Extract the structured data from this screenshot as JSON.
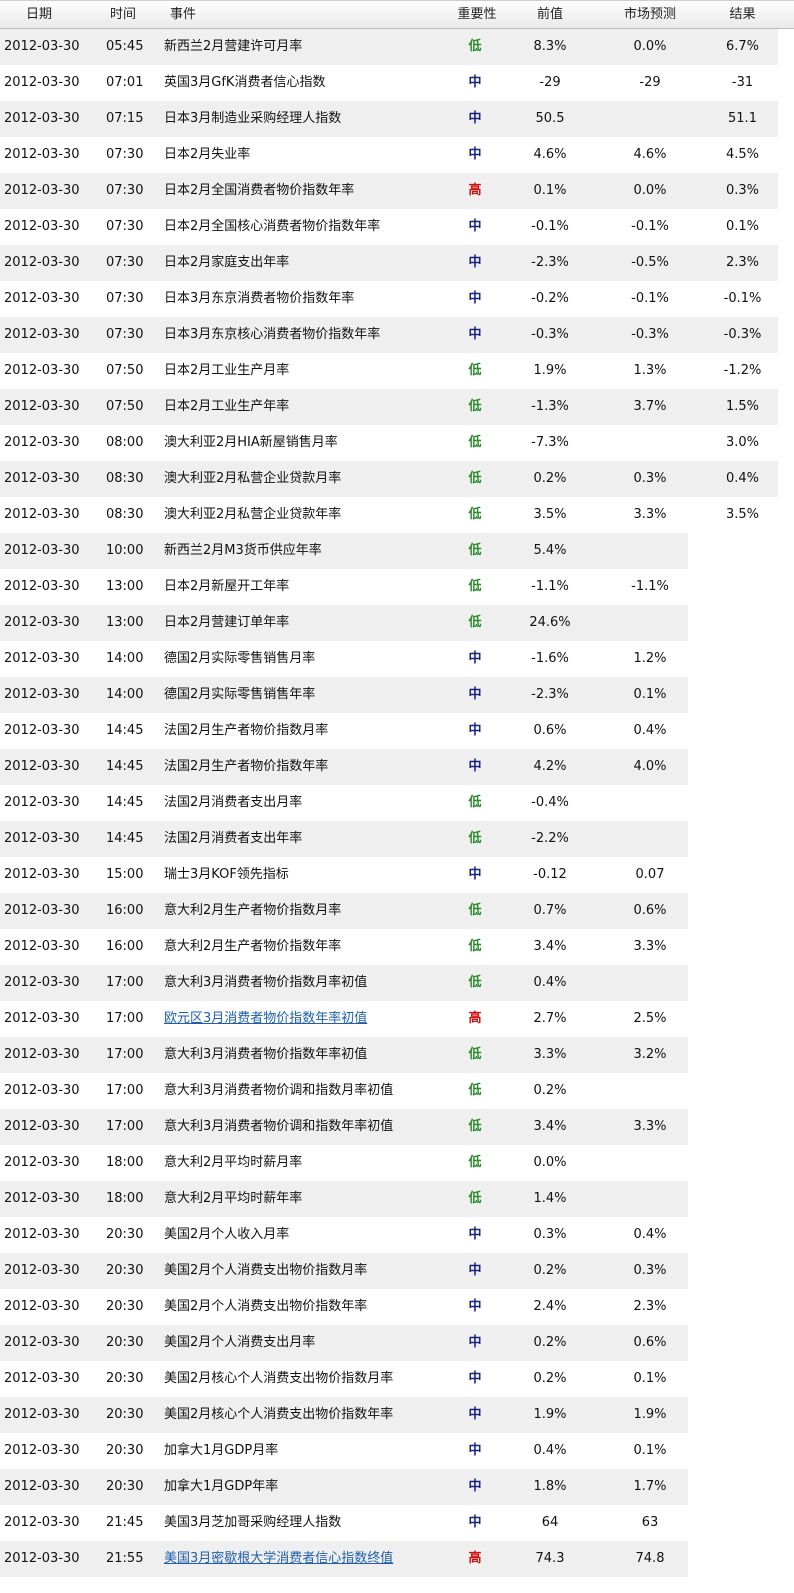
{
  "header": {
    "date": "日期",
    "time": "时间",
    "event": "事件",
    "importance": "重要性",
    "previous": "前值",
    "forecast": "市场预测",
    "actual": "结果"
  },
  "colors": {
    "low": "#2e8b2e",
    "medium": "#1a237e",
    "high": "#cc1111",
    "link": "#1f5fae"
  },
  "rows": [
    {
      "date": "2012-03-30",
      "time": "05:45",
      "event": "新西兰2月营建许可月率",
      "imp": "低",
      "prev": "8.3%",
      "fore": "0.0%",
      "act": "6.7%",
      "link": false
    },
    {
      "date": "2012-03-30",
      "time": "07:01",
      "event": "英国3月GfK消费者信心指数",
      "imp": "中",
      "prev": "-29",
      "fore": "-29",
      "act": "-31",
      "link": false
    },
    {
      "date": "2012-03-30",
      "time": "07:15",
      "event": "日本3月制造业采购经理人指数",
      "imp": "中",
      "prev": "50.5",
      "fore": "",
      "act": "51.1",
      "link": false
    },
    {
      "date": "2012-03-30",
      "time": "07:30",
      "event": "日本2月失业率",
      "imp": "中",
      "prev": "4.6%",
      "fore": "4.6%",
      "act": "4.5%",
      "link": false
    },
    {
      "date": "2012-03-30",
      "time": "07:30",
      "event": "日本2月全国消费者物价指数年率",
      "imp": "高",
      "prev": "0.1%",
      "fore": "0.0%",
      "act": "0.3%",
      "link": false
    },
    {
      "date": "2012-03-30",
      "time": "07:30",
      "event": "日本2月全国核心消费者物价指数年率",
      "imp": "中",
      "prev": "-0.1%",
      "fore": "-0.1%",
      "act": "0.1%",
      "link": false
    },
    {
      "date": "2012-03-30",
      "time": "07:30",
      "event": "日本2月家庭支出年率",
      "imp": "中",
      "prev": "-2.3%",
      "fore": "-0.5%",
      "act": "2.3%",
      "link": false
    },
    {
      "date": "2012-03-30",
      "time": "07:30",
      "event": "日本3月东京消费者物价指数年率",
      "imp": "中",
      "prev": "-0.2%",
      "fore": "-0.1%",
      "act": "-0.1%",
      "link": false
    },
    {
      "date": "2012-03-30",
      "time": "07:30",
      "event": "日本3月东京核心消费者物价指数年率",
      "imp": "中",
      "prev": "-0.3%",
      "fore": "-0.3%",
      "act": "-0.3%",
      "link": false
    },
    {
      "date": "2012-03-30",
      "time": "07:50",
      "event": "日本2月工业生产月率",
      "imp": "低",
      "prev": "1.9%",
      "fore": "1.3%",
      "act": "-1.2%",
      "link": false
    },
    {
      "date": "2012-03-30",
      "time": "07:50",
      "event": "日本2月工业生产年率",
      "imp": "低",
      "prev": "-1.3%",
      "fore": "3.7%",
      "act": "1.5%",
      "link": false
    },
    {
      "date": "2012-03-30",
      "time": "08:00",
      "event": "澳大利亚2月HIA新屋销售月率",
      "imp": "低",
      "prev": "-7.3%",
      "fore": "",
      "act": "3.0%",
      "link": false
    },
    {
      "date": "2012-03-30",
      "time": "08:30",
      "event": "澳大利亚2月私营企业贷款月率",
      "imp": "低",
      "prev": "0.2%",
      "fore": "0.3%",
      "act": "0.4%",
      "link": false
    },
    {
      "date": "2012-03-30",
      "time": "08:30",
      "event": "澳大利亚2月私营企业贷款年率",
      "imp": "低",
      "prev": "3.5%",
      "fore": "3.3%",
      "act": "3.5%",
      "link": false
    },
    {
      "date": "2012-03-30",
      "time": "10:00",
      "event": "新西兰2月M3货币供应年率",
      "imp": "低",
      "prev": "5.4%",
      "fore": "",
      "act": "",
      "link": false
    },
    {
      "date": "2012-03-30",
      "time": "13:00",
      "event": "日本2月新屋开工年率",
      "imp": "低",
      "prev": "-1.1%",
      "fore": "-1.1%",
      "act": "",
      "link": false
    },
    {
      "date": "2012-03-30",
      "time": "13:00",
      "event": "日本2月营建订单年率",
      "imp": "低",
      "prev": "24.6%",
      "fore": "",
      "act": "",
      "link": false
    },
    {
      "date": "2012-03-30",
      "time": "14:00",
      "event": "德国2月实际零售销售月率",
      "imp": "中",
      "prev": "-1.6%",
      "fore": "1.2%",
      "act": "",
      "link": false
    },
    {
      "date": "2012-03-30",
      "time": "14:00",
      "event": "德国2月实际零售销售年率",
      "imp": "中",
      "prev": "-2.3%",
      "fore": "0.1%",
      "act": "",
      "link": false
    },
    {
      "date": "2012-03-30",
      "time": "14:45",
      "event": "法国2月生产者物价指数月率",
      "imp": "中",
      "prev": "0.6%",
      "fore": "0.4%",
      "act": "",
      "link": false
    },
    {
      "date": "2012-03-30",
      "time": "14:45",
      "event": "法国2月生产者物价指数年率",
      "imp": "中",
      "prev": "4.2%",
      "fore": "4.0%",
      "act": "",
      "link": false
    },
    {
      "date": "2012-03-30",
      "time": "14:45",
      "event": "法国2月消费者支出月率",
      "imp": "低",
      "prev": "-0.4%",
      "fore": "",
      "act": "",
      "link": false
    },
    {
      "date": "2012-03-30",
      "time": "14:45",
      "event": "法国2月消费者支出年率",
      "imp": "低",
      "prev": "-2.2%",
      "fore": "",
      "act": "",
      "link": false
    },
    {
      "date": "2012-03-30",
      "time": "15:00",
      "event": "瑞士3月KOF领先指标",
      "imp": "中",
      "prev": "-0.12",
      "fore": "0.07",
      "act": "",
      "link": false
    },
    {
      "date": "2012-03-30",
      "time": "16:00",
      "event": "意大利2月生产者物价指数月率",
      "imp": "低",
      "prev": "0.7%",
      "fore": "0.6%",
      "act": "",
      "link": false
    },
    {
      "date": "2012-03-30",
      "time": "16:00",
      "event": "意大利2月生产者物价指数年率",
      "imp": "低",
      "prev": "3.4%",
      "fore": "3.3%",
      "act": "",
      "link": false
    },
    {
      "date": "2012-03-30",
      "time": "17:00",
      "event": "意大利3月消费者物价指数月率初值",
      "imp": "低",
      "prev": "0.4%",
      "fore": "",
      "act": "",
      "link": false
    },
    {
      "date": "2012-03-30",
      "time": "17:00",
      "event": "欧元区3月消费者物价指数年率初值",
      "imp": "高",
      "prev": "2.7%",
      "fore": "2.5%",
      "act": "",
      "link": true
    },
    {
      "date": "2012-03-30",
      "time": "17:00",
      "event": "意大利3月消费者物价指数年率初值",
      "imp": "低",
      "prev": "3.3%",
      "fore": "3.2%",
      "act": "",
      "link": false
    },
    {
      "date": "2012-03-30",
      "time": "17:00",
      "event": "意大利3月消费者物价调和指数月率初值",
      "imp": "低",
      "prev": "0.2%",
      "fore": "",
      "act": "",
      "link": false
    },
    {
      "date": "2012-03-30",
      "time": "17:00",
      "event": "意大利3月消费者物价调和指数年率初值",
      "imp": "低",
      "prev": "3.4%",
      "fore": "3.3%",
      "act": "",
      "link": false
    },
    {
      "date": "2012-03-30",
      "time": "18:00",
      "event": "意大利2月平均时薪月率",
      "imp": "低",
      "prev": "0.0%",
      "fore": "",
      "act": "",
      "link": false
    },
    {
      "date": "2012-03-30",
      "time": "18:00",
      "event": "意大利2月平均时薪年率",
      "imp": "低",
      "prev": "1.4%",
      "fore": "",
      "act": "",
      "link": false
    },
    {
      "date": "2012-03-30",
      "time": "20:30",
      "event": "美国2月个人收入月率",
      "imp": "中",
      "prev": "0.3%",
      "fore": "0.4%",
      "act": "",
      "link": false
    },
    {
      "date": "2012-03-30",
      "time": "20:30",
      "event": "美国2月个人消费支出物价指数月率",
      "imp": "中",
      "prev": "0.2%",
      "fore": "0.3%",
      "act": "",
      "link": false
    },
    {
      "date": "2012-03-30",
      "time": "20:30",
      "event": "美国2月个人消费支出物价指数年率",
      "imp": "中",
      "prev": "2.4%",
      "fore": "2.3%",
      "act": "",
      "link": false
    },
    {
      "date": "2012-03-30",
      "time": "20:30",
      "event": "美国2月个人消费支出月率",
      "imp": "中",
      "prev": "0.2%",
      "fore": "0.6%",
      "act": "",
      "link": false
    },
    {
      "date": "2012-03-30",
      "time": "20:30",
      "event": "美国2月核心个人消费支出物价指数月率",
      "imp": "中",
      "prev": "0.2%",
      "fore": "0.1%",
      "act": "",
      "link": false
    },
    {
      "date": "2012-03-30",
      "time": "20:30",
      "event": "美国2月核心个人消费支出物价指数年率",
      "imp": "中",
      "prev": "1.9%",
      "fore": "1.9%",
      "act": "",
      "link": false
    },
    {
      "date": "2012-03-30",
      "time": "20:30",
      "event": "加拿大1月GDP月率",
      "imp": "中",
      "prev": "0.4%",
      "fore": "0.1%",
      "act": "",
      "link": false
    },
    {
      "date": "2012-03-30",
      "time": "20:30",
      "event": "加拿大1月GDP年率",
      "imp": "中",
      "prev": "1.8%",
      "fore": "1.7%",
      "act": "",
      "link": false
    },
    {
      "date": "2012-03-30",
      "time": "21:45",
      "event": "美国3月芝加哥采购经理人指数",
      "imp": "中",
      "prev": "64",
      "fore": "63",
      "act": "",
      "link": false
    },
    {
      "date": "2012-03-30",
      "time": "21:55",
      "event": "美国3月密歇根大学消费者信心指数终值",
      "imp": "高",
      "prev": "74.3",
      "fore": "74.8",
      "act": "",
      "link": true
    }
  ]
}
